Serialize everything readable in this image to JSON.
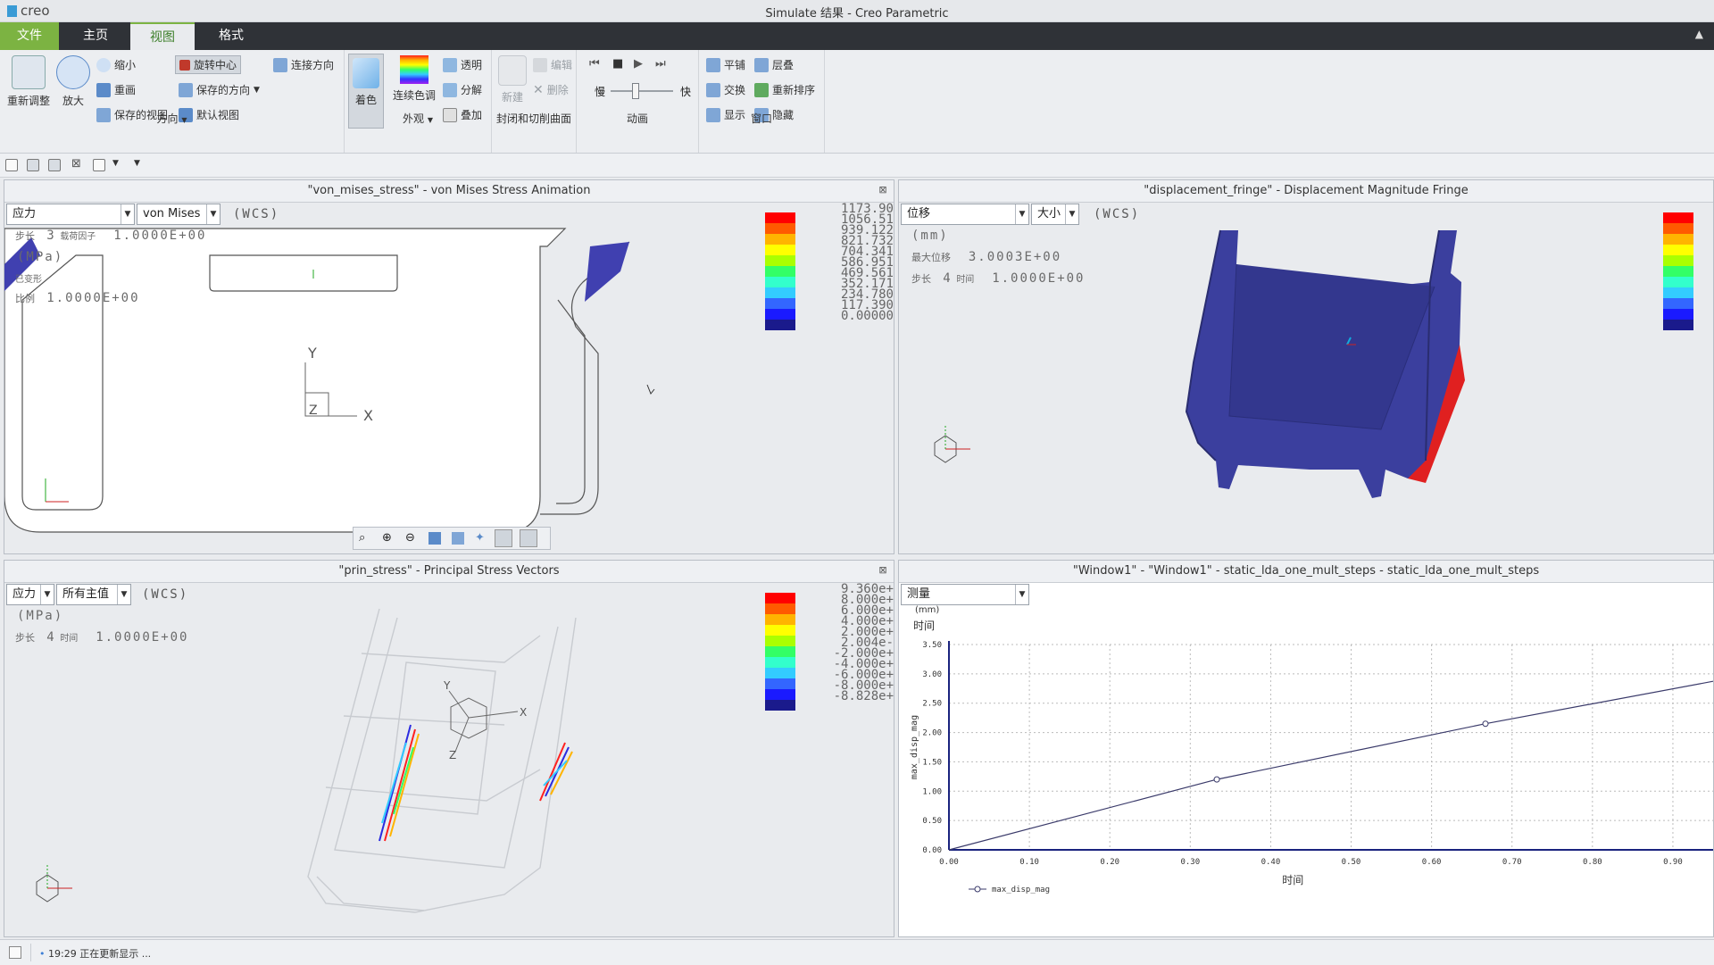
{
  "app": {
    "logo_text": "creo",
    "window_title": "Simulate 结果 - Creo Parametric"
  },
  "tabs": [
    {
      "label": "文件"
    },
    {
      "label": "主页"
    },
    {
      "label": "视图"
    },
    {
      "label": "格式"
    }
  ],
  "ribbon": {
    "orientation": {
      "group_label": "方向",
      "refit": "重新调整",
      "zoom_in": "放大",
      "zoom_out": "缩小",
      "repaint": "重画",
      "saved_views": "保存的视图",
      "spin_center": "旋转中心",
      "saved_orientations": "保存的方向",
      "default_view": "默认视图",
      "connect_direction": "连接方向"
    },
    "appearance": {
      "group_label": "外观",
      "shading": "着色",
      "continuous_tone": "连续色调",
      "transparent": "透明",
      "explode": "分解",
      "overlay": "叠加"
    },
    "capping": {
      "group_label": "封闭和切削曲面",
      "new": "新建",
      "edit": "编辑",
      "delete": "删除"
    },
    "animation": {
      "group_label": "动画",
      "slow": "慢",
      "fast": "快",
      "speed": 0.4
    },
    "window": {
      "group_label": "窗口",
      "tile": "平铺",
      "cascade": "层叠",
      "swap": "交换",
      "reorder": "重新排序",
      "show": "显示",
      "hide": "隐藏"
    }
  },
  "panes": {
    "vm": {
      "title": "\"von_mises_stress\" - von Mises Stress Animation",
      "dd1": "应力",
      "dd2": "von Mises",
      "wcs": "(WCS)",
      "info_step_label": "步长",
      "info_step": "3",
      "info_load_label": "载荷因子",
      "info_load": "1.0000E+00",
      "unit": "(MPa)",
      "deformed_label": "已变形",
      "scale_label": "比例",
      "scale": "1.0000E+00",
      "legend": [
        "1173.90",
        "1056.51",
        "939.122",
        "821.732",
        "704.341",
        "586.951",
        "469.561",
        "352.171",
        "234.780",
        "117.390",
        "0.00000"
      ],
      "axis_x": "X",
      "axis_y": "Y",
      "axis_z": "Z"
    },
    "disp": {
      "title": "\"displacement_fringe\" - Displacement Magnitude Fringe",
      "dd1": "位移",
      "dd2": "大小",
      "wcs": "(WCS)",
      "unit": "(mm)",
      "max_label": "最大位移",
      "max_value": "3.0003E+00",
      "step_label": "步长",
      "step": "4",
      "time_label": "时间",
      "time_value": "1.0000E+00"
    },
    "prin": {
      "title": "\"prin_stress\" - Principal Stress Vectors",
      "dd1": "应力",
      "dd2": "所有主值",
      "wcs": "(WCS)",
      "unit": "(MPa)",
      "step_label": "步长",
      "step": "4",
      "time_label": "时间",
      "time_value": "1.0000E+00",
      "legend": [
        "9.360e+",
        "8.000e+",
        "6.000e+",
        "4.000e+",
        "2.000e+",
        "2.004e-",
        "-2.000e+",
        "-4.000e+",
        "-6.000e+",
        "-8.000e+",
        "-8.828e+"
      ],
      "axis_x": "X",
      "axis_y": "Y",
      "axis_z": "Z"
    },
    "graph": {
      "title": "\"Window1\" - \"Window1\" - static_lda_one_mult_steps - static_lda_one_mult_steps",
      "dd1": "测量",
      "unit_top": "(mm)",
      "axis_top_label": "时间"
    }
  },
  "chart_data": {
    "type": "line",
    "xlabel": "时间",
    "ylabel": "max_disp_mag",
    "xlim": [
      0,
      0.95
    ],
    "ylim": [
      0,
      3.5
    ],
    "xticks": [
      "0.00",
      "0.10",
      "0.20",
      "0.30",
      "0.40",
      "0.50",
      "0.60",
      "0.70",
      "0.80",
      "0.90"
    ],
    "yticks": [
      "0.00",
      "0.50",
      "1.00",
      "1.50",
      "2.00",
      "2.50",
      "3.00",
      "3.50"
    ],
    "grid": true,
    "legend_position": "bottom-left",
    "series": [
      {
        "name": "max_disp_mag",
        "x": [
          0,
          0.333,
          0.667,
          1.0
        ],
        "y": [
          0,
          1.2,
          2.15,
          3.0
        ]
      }
    ],
    "marker_points": [
      {
        "x": 0.333,
        "y": 1.2
      },
      {
        "x": 0.667,
        "y": 2.15
      }
    ]
  },
  "status": {
    "message": "19:29 正在更新显示 ..."
  },
  "colors": {
    "file_tab": "#7cb342",
    "fringe": [
      "#ff0000",
      "#ff5a00",
      "#ffb400",
      "#ffff00",
      "#aaff00",
      "#33ff66",
      "#33ffcc",
      "#33ccff",
      "#3366ff",
      "#1a1aff",
      "#1a1a8c"
    ],
    "part_blue": "#3b3f9e",
    "part_red": "#e02020"
  }
}
